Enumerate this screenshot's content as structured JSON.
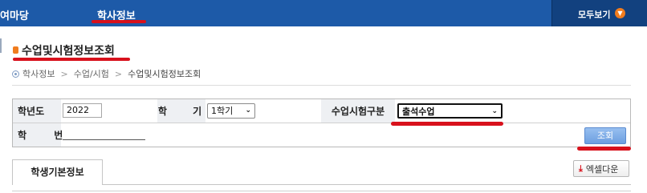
{
  "nav": {
    "items": [
      {
        "label": "여마당"
      },
      {
        "label": "학사정보"
      }
    ],
    "view_all": "모두보기",
    "view_all_icon": "chevron-down-circle-icon"
  },
  "page": {
    "title": "수업및시험정보조회"
  },
  "breadcrumb": {
    "items": [
      "학사정보",
      "수업/시험",
      "수업및시험정보조회"
    ],
    "separator": ">"
  },
  "form": {
    "year_label": "학년도",
    "year_value": "2022",
    "term_label": "학 기",
    "term_value": "1학기",
    "type_label": "수업시험구분",
    "type_value": "출석수업",
    "student_no_label": "학 번",
    "student_no_value": "",
    "search_button": "조회"
  },
  "tabs": {
    "items": [
      {
        "label": "학생기본정보"
      }
    ]
  },
  "excel_button": "엑셀다운",
  "colors": {
    "nav_bg": "#1d5aa8",
    "nav_dark": "#12417f",
    "accent_orange": "#f07c1e",
    "annotation_red": "#d8111c",
    "search_button": "#7aa8e6"
  }
}
